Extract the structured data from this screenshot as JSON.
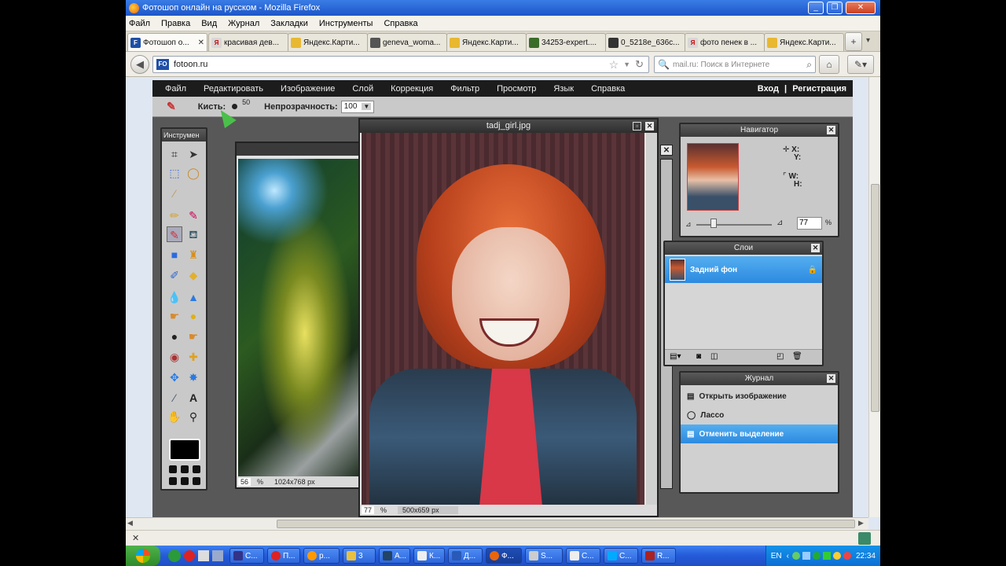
{
  "window": {
    "title": "Фотошоп онлайн на русском - Mozilla Firefox"
  },
  "menubar": [
    "Файл",
    "Правка",
    "Вид",
    "Журнал",
    "Закладки",
    "Инструменты",
    "Справка"
  ],
  "tabs": [
    {
      "label": "Фотошоп о...",
      "icon": "fo",
      "active": true
    },
    {
      "label": "красивая дев...",
      "icon": "ya"
    },
    {
      "label": "Яндекс.Карти...",
      "icon": "folder"
    },
    {
      "label": "geneva_woma...",
      "icon": "img"
    },
    {
      "label": "Яндекс.Карти...",
      "icon": "folder"
    },
    {
      "label": "34253-expert....",
      "icon": "img"
    },
    {
      "label": "0_5218e_636c...",
      "icon": "img"
    },
    {
      "label": "фото пенек в ...",
      "icon": "ya"
    },
    {
      "label": "Яндекс.Карти...",
      "icon": "folder"
    }
  ],
  "nav": {
    "url": "fotoon.ru",
    "search_placeholder": "mail.ru: Поиск в Интернете"
  },
  "pixlr": {
    "menu": [
      "Файл",
      "Редактировать",
      "Изображение",
      "Слой",
      "Коррекция",
      "Фильтр",
      "Просмотр",
      "Язык",
      "Справка"
    ],
    "login": "Вход",
    "separator": "|",
    "register": "Регистрация",
    "options": {
      "brush_label": "Кисть:",
      "brush_size": "50",
      "opacity_label": "Непрозрачность:",
      "opacity_value": "100"
    },
    "tools_title": "Инструмен",
    "navigator": {
      "title": "Навигатор",
      "x_label": "X:",
      "y_label": "Y:",
      "w_label": "W:",
      "h_label": "H:",
      "zoom": "77",
      "percent": "%"
    },
    "layers": {
      "title": "Слои",
      "layer_name": "Задний фон"
    },
    "history": {
      "title": "Журнал",
      "items": [
        "Открыть изображение",
        "Лассо",
        "Отменить выделение"
      ]
    },
    "image1": {
      "zoom": "56",
      "percent": "%",
      "size": "1024x768 px"
    },
    "image2": {
      "title": "tadj_girl.jpg",
      "zoom": "77",
      "percent": "%",
      "size": "500x659 px"
    }
  },
  "taskbar": {
    "items": [
      "С...",
      "П...",
      "р...",
      "3",
      "А...",
      "К...",
      "Д...",
      "Ф...",
      "S...",
      "С...",
      "С...",
      "R..."
    ],
    "lang": "EN",
    "clock": "22:34"
  },
  "colors": {
    "pixlr_bar": "#1c1c1c",
    "selection": "#3a9bea",
    "xp_blue": "#245ad8"
  }
}
